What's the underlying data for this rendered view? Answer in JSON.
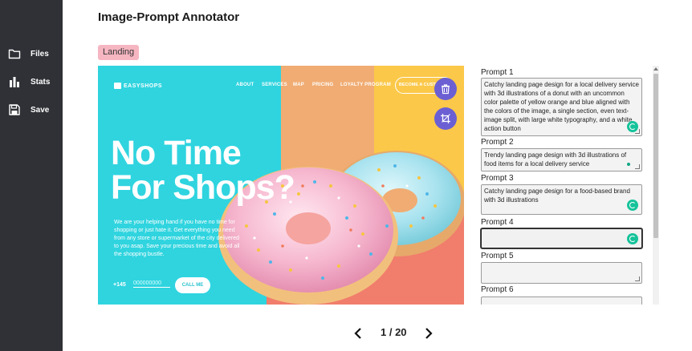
{
  "app": {
    "title": "Image-Prompt Annotator"
  },
  "sidebar": {
    "items": [
      {
        "label": "Files",
        "icon": "folder-icon"
      },
      {
        "label": "Stats",
        "icon": "bar-chart-icon"
      },
      {
        "label": "Save",
        "icon": "floppy-disk-icon"
      }
    ]
  },
  "image": {
    "tag": "Landing",
    "logo": "EASYSHOPS",
    "menu": [
      "ABOUT",
      "SERVICES",
      "MAP",
      "PRICING",
      "LOYALTY PROGRAM"
    ],
    "cta": "BECOME A CUSTOMER",
    "headline_line1": "No Time",
    "headline_line2": "For Shops?",
    "body": "We are your helping hand if you have no time for shopping or just hate it. Get everything you need from any store or supermarket of the city delivered to you asap. Save your precious time and avoid all the shopping bustle.",
    "phone_prefix": "+145",
    "phone_placeholder": "000000000",
    "call_button": "CALL ME"
  },
  "actions": {
    "delete_icon": "trash-icon",
    "crop_icon": "crop-icon"
  },
  "prompts": [
    {
      "label": "Prompt 1",
      "value": "Catchy landing page design for a local delivery service with 3d illustrations of a donut with an uncommon color palette of yellow orange and blue aligned with the colors of the image, a single section, even text-image split, with large white typography, and a white action button"
    },
    {
      "label": "Prompt 2",
      "value": "Trendy landing page design with 3d illustrations of food items for a local delivery service"
    },
    {
      "label": "Prompt 3",
      "value": "Catchy landing page design for a food-based brand with 3d illustrations"
    },
    {
      "label": "Prompt 4",
      "value": ""
    },
    {
      "label": "Prompt 5",
      "value": ""
    },
    {
      "label": "Prompt 6",
      "value": ""
    }
  ],
  "pagination": {
    "text": "1 / 20"
  },
  "colors": {
    "sidebar": "#2f3136",
    "tag": "#f6b6c1",
    "fab": "#6b5fd3",
    "hero_cyan": "#2fd4df",
    "hero_orange": "#f0ac73",
    "hero_yellow": "#fbc849"
  }
}
